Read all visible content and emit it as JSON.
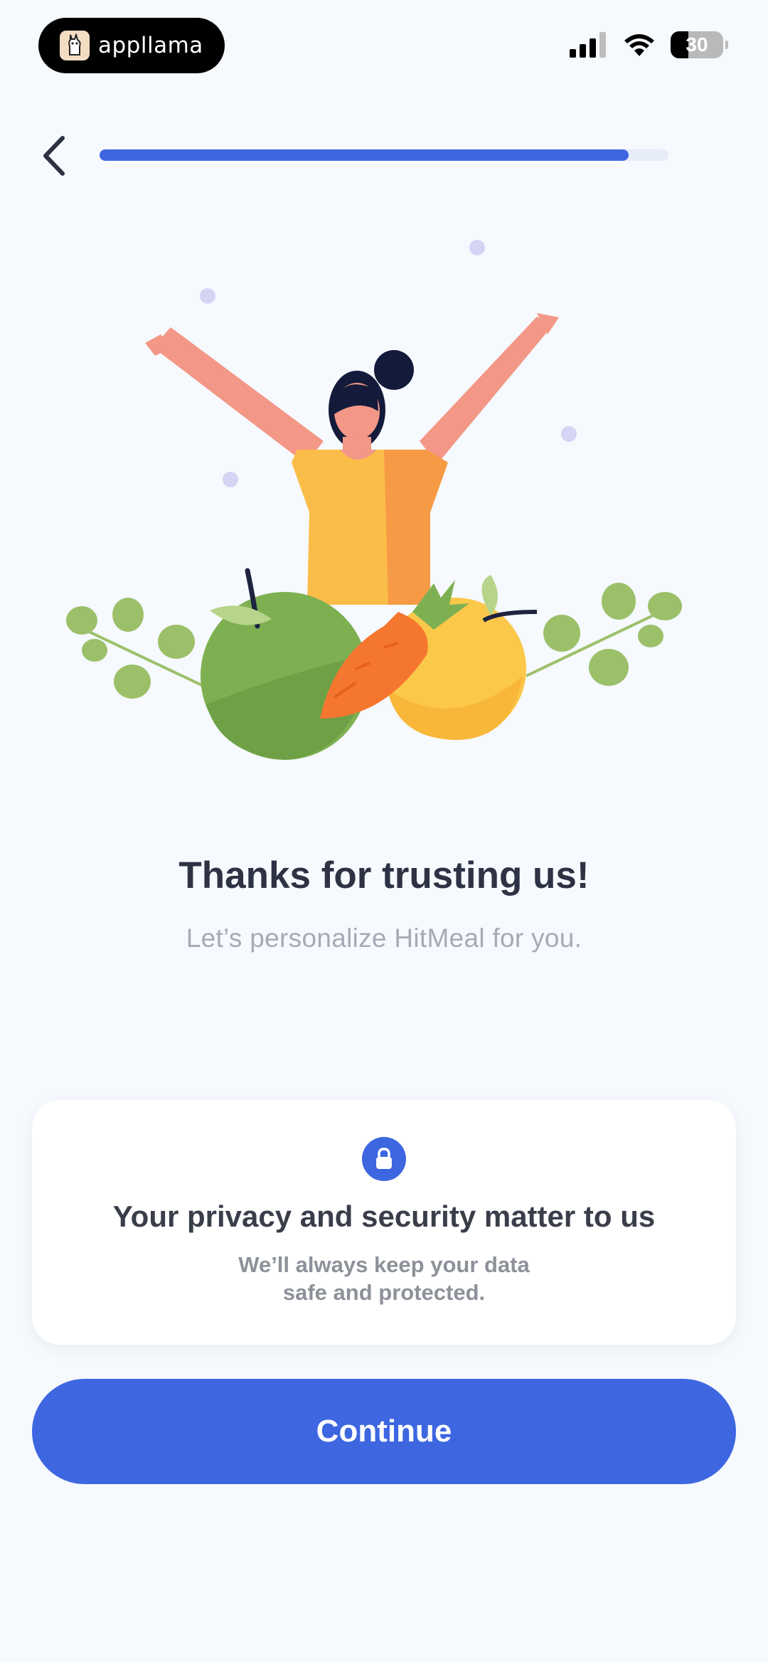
{
  "status_bar": {
    "app_name": "appllama",
    "battery": "30"
  },
  "progress": {
    "fraction": 0.93
  },
  "heading": {
    "title": "Thanks for trusting us!",
    "subtitle": "Let’s personalize HitMeal for you."
  },
  "privacy_card": {
    "title": "Your privacy and security matter to us",
    "body_line1": "We’ll always keep your data",
    "body_line2": "safe and protected."
  },
  "continue_label": "Continue",
  "colors": {
    "accent": "#3d66e0",
    "background": "#f6f9fd",
    "title_text": "#2d3244",
    "muted_text": "#a5abb6"
  },
  "icons": [
    "back-chevron-icon",
    "signal-icon",
    "wifi-icon",
    "battery-icon",
    "lock-icon"
  ]
}
